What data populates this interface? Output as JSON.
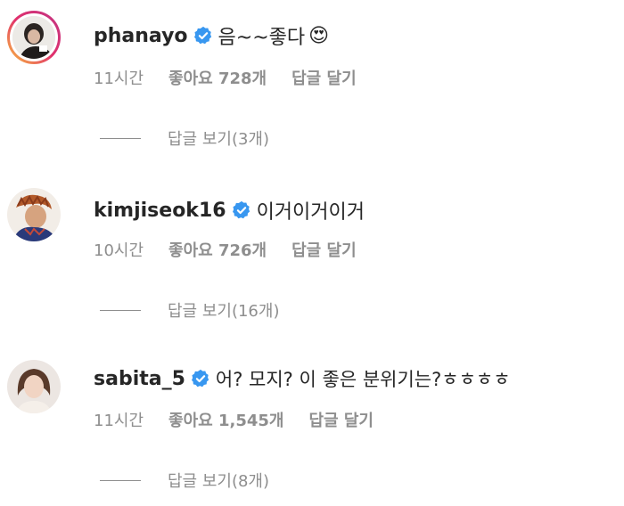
{
  "comments": [
    {
      "username": "phanayo",
      "text": "음~~좋다",
      "emoji": "😍",
      "time": "11시간",
      "likes": "좋아요 728개",
      "reply_label": "답글 달기",
      "view_replies": "답글 보기(3개)",
      "has_story_ring": true
    },
    {
      "username": "kimjiseok16",
      "text": "이거이거이거",
      "emoji": "",
      "time": "10시간",
      "likes": "좋아요 726개",
      "reply_label": "답글 달기",
      "view_replies": "답글 보기(16개)",
      "has_story_ring": false
    },
    {
      "username": "sabita_5",
      "text": "어? 모지? 이 좋은 분위기는?ㅎㅎㅎㅎ",
      "emoji": "",
      "time": "11시간",
      "likes": "좋아요 1,545개",
      "reply_label": "답글 달기",
      "view_replies": "답글 보기(8개)",
      "has_story_ring": false
    }
  ],
  "colors": {
    "verified": "#3897f0",
    "secondary_text": "#8e8e8e",
    "primary_text": "#262626"
  }
}
